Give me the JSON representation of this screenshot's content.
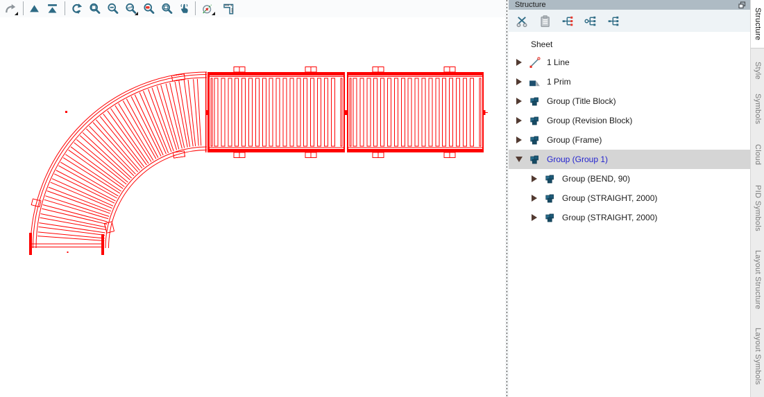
{
  "colors": {
    "drawing_red": "#ff0000",
    "icon_teal": "#2e6b85",
    "selection_bg": "#d5d5d5",
    "selection_text": "#2323cf",
    "panel_header_bg": "#aebbc4"
  },
  "main_toolbar": {
    "buttons": [
      {
        "icon": "redo-arrow",
        "dropdown": true
      },
      {
        "icon": "triangle-up",
        "dropdown": false
      },
      {
        "icon": "triangle-up-bar",
        "dropdown": false
      },
      {
        "icon": "refresh",
        "dropdown": false
      },
      {
        "icon": "zoom-window",
        "dropdown": false
      },
      {
        "icon": "zoom-out",
        "dropdown": false
      },
      {
        "icon": "zoom-name",
        "dropdown": true
      },
      {
        "icon": "zoom-red",
        "dropdown": false
      },
      {
        "icon": "zoom-sheet",
        "dropdown": false
      },
      {
        "icon": "pan-hand",
        "dropdown": false
      },
      {
        "icon": "measure-circle",
        "dropdown": true
      },
      {
        "icon": "ruler",
        "dropdown": false
      }
    ]
  },
  "structure_panel": {
    "title": "Structure",
    "float_icon": "float-window",
    "toolbar": [
      {
        "icon": "cut"
      },
      {
        "icon": "paste"
      },
      {
        "icon": "tree-insert-red"
      },
      {
        "icon": "tree-extract"
      },
      {
        "icon": "tree-structure"
      }
    ],
    "root_label": "Sheet",
    "items": [
      {
        "label": "1 Line",
        "icon": "line",
        "expandable": true,
        "selected": false
      },
      {
        "label": "1 Prim",
        "icon": "prim",
        "expandable": true,
        "selected": false
      },
      {
        "label": "Group (Title Block)",
        "icon": "group",
        "expandable": true,
        "selected": false
      },
      {
        "label": "Group (Revision Block)",
        "icon": "group",
        "expandable": true,
        "selected": false
      },
      {
        "label": "Group (Frame)",
        "icon": "group",
        "expandable": true,
        "selected": false
      },
      {
        "label": "Group (Group 1)",
        "icon": "group",
        "expandable": true,
        "selected": true,
        "expanded": true,
        "children": [
          {
            "label": "Group (BEND, 90)",
            "icon": "group",
            "expandable": true
          },
          {
            "label": "Group (STRAIGHT, 2000)",
            "icon": "group",
            "expandable": true
          },
          {
            "label": "Group (STRAIGHT, 2000)",
            "icon": "group",
            "expandable": true
          }
        ]
      }
    ]
  },
  "side_tabs": {
    "active": "Structure",
    "tabs": [
      "Structure",
      "Style",
      "Symbols",
      "Cloud",
      "PID Symbols",
      "Layout Structure",
      "Layout Symbols"
    ]
  },
  "canvas": {
    "selected_entities": [
      "Group (BEND, 90)",
      "Group (STRAIGHT, 2000)",
      "Group (STRAIGHT, 2000)"
    ]
  }
}
